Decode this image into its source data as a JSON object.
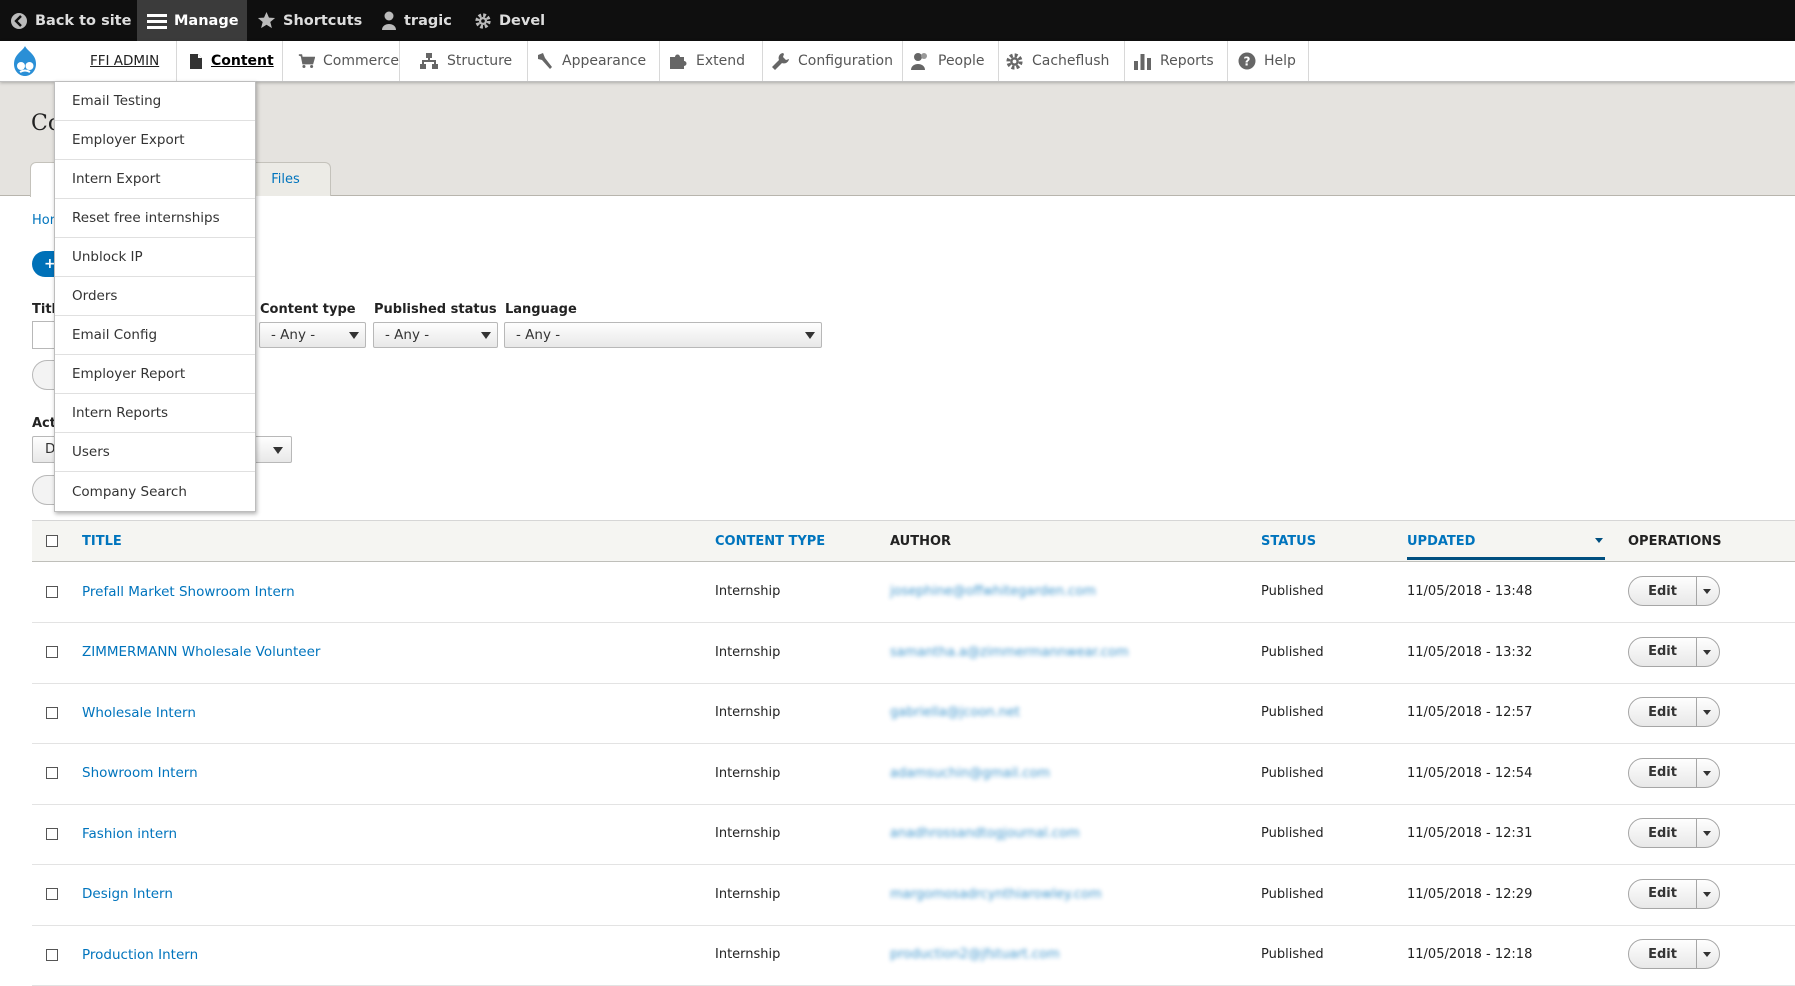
{
  "toolbar": {
    "back_to_site": "Back to site",
    "manage": "Manage",
    "shortcuts": "Shortcuts",
    "user": "tragic",
    "devel": "Devel"
  },
  "tray": {
    "ffi_admin": "FFI ADMIN",
    "items": [
      "Content",
      "Commerce",
      "Structure",
      "Appearance",
      "Extend",
      "Configuration",
      "People",
      "Cacheflush",
      "Reports",
      "Help"
    ]
  },
  "dropdown": {
    "items": [
      "Email Testing",
      "Employer Export",
      "Intern Export",
      "Reset free internships",
      "Unblock IP",
      "Orders",
      "Email Config",
      "Employer Report",
      "Intern Reports",
      "Users",
      "Company Search"
    ]
  },
  "page": {
    "title_partial": "Co",
    "tab_files": "Files",
    "breadcrumb_partial": "Hor",
    "add_partial": "+",
    "title_label_partial": "Titl",
    "action_label_partial": "Act",
    "action_select_partial": "D"
  },
  "filters": {
    "content_type_label": "Content type",
    "content_type_value": "- Any -",
    "published_status_label": "Published status",
    "published_status_value": "- Any -",
    "language_label": "Language",
    "language_value": "- Any -"
  },
  "table": {
    "headers": {
      "title": "TITLE",
      "content_type": "CONTENT TYPE",
      "author": "AUTHOR",
      "status": "STATUS",
      "updated": "UPDATED",
      "operations": "OPERATIONS"
    },
    "edit_label": "Edit",
    "rows": [
      {
        "title": "Prefall Market Showroom Intern",
        "type": "Internship",
        "author": "josephine@offwhitegarden.com",
        "status": "Published",
        "updated": "11/05/2018 - 13:48"
      },
      {
        "title": "ZIMMERMANN Wholesale Volunteer",
        "type": "Internship",
        "author": "samantha.a@zimmermannwear.com",
        "status": "Published",
        "updated": "11/05/2018 - 13:32"
      },
      {
        "title": "Wholesale Intern",
        "type": "Internship",
        "author": "gabriella@jcoon.net",
        "status": "Published",
        "updated": "11/05/2018 - 12:57"
      },
      {
        "title": "Showroom Intern",
        "type": "Internship",
        "author": "adamsuchin@gmail.com",
        "status": "Published",
        "updated": "11/05/2018 - 12:54"
      },
      {
        "title": "Fashion intern",
        "type": "Internship",
        "author": "anadhrossandtogjournal.com",
        "status": "Published",
        "updated": "11/05/2018 - 12:31"
      },
      {
        "title": "Design Intern",
        "type": "Internship",
        "author": "margomosadrcynthiarowley.com",
        "status": "Published",
        "updated": "11/05/2018 - 12:29"
      },
      {
        "title": "Production Intern",
        "type": "Internship",
        "author": "production2@jfstuart.com",
        "status": "Published",
        "updated": "11/05/2018 - 12:18"
      }
    ]
  }
}
